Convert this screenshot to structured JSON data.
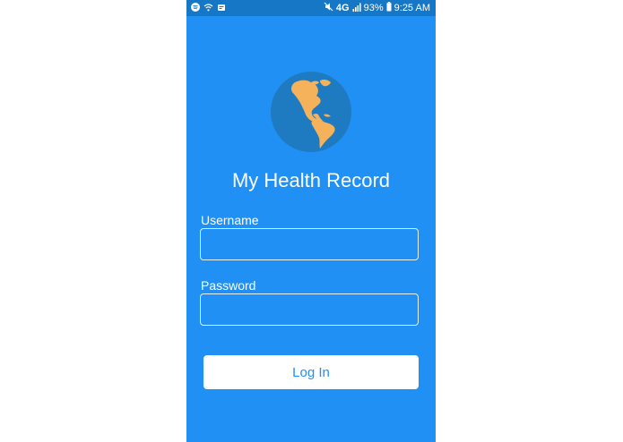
{
  "status_bar": {
    "network_label": "4G",
    "battery_percent": "93%",
    "time": "9:25 AM",
    "icons": [
      "spotify-icon",
      "wifi-icon",
      "notification-icon",
      "mute-icon",
      "signal-icon",
      "battery-icon"
    ]
  },
  "app": {
    "title": "My Health Record",
    "logo_icon": "globe-icon"
  },
  "form": {
    "username_label": "Username",
    "username_value": "",
    "password_label": "Password",
    "password_value": "",
    "login_button_label": "Log In"
  },
  "colors": {
    "background": "#2190f5",
    "status_bar": "#1577c6",
    "globe_ocean": "#1f7bc1",
    "globe_land": "#f5b25a",
    "button_bg": "#ffffff",
    "button_text": "#2190f5"
  }
}
